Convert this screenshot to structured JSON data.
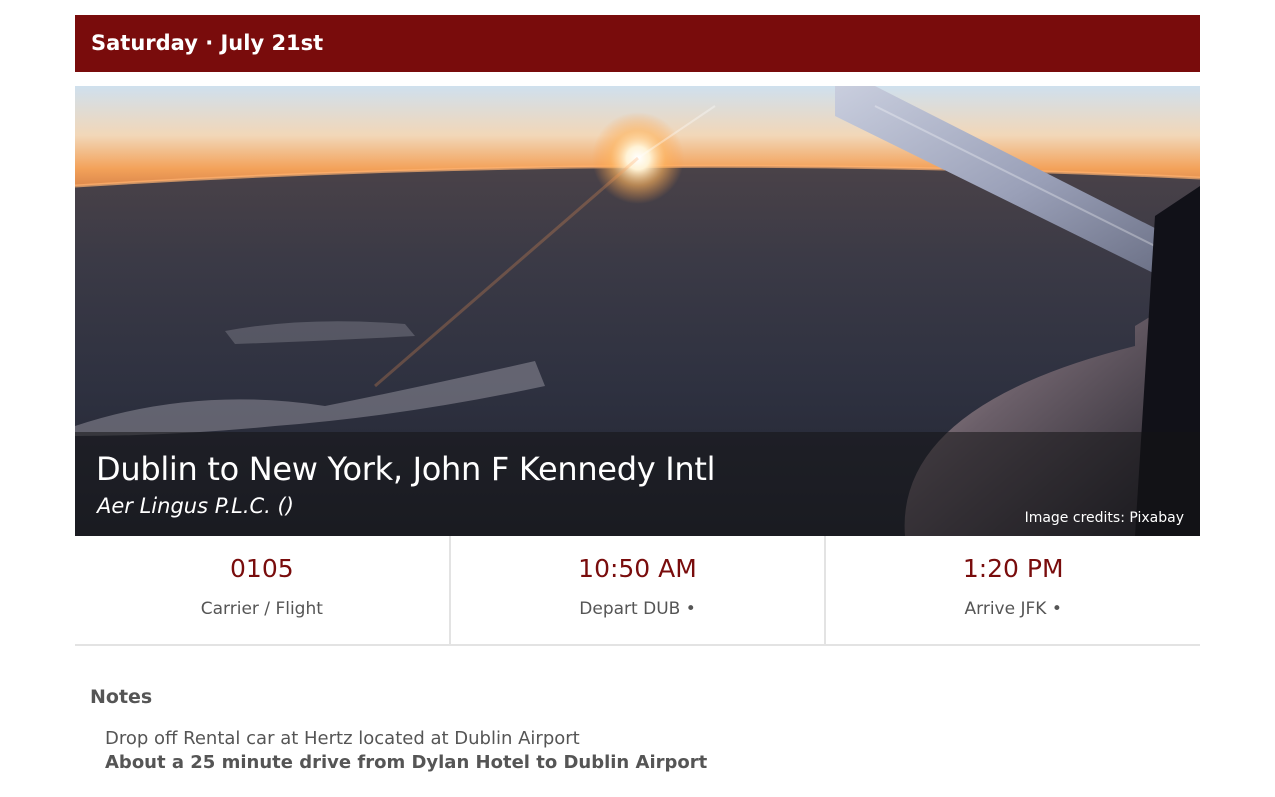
{
  "header": {
    "date_label": "Saturday · July 21st"
  },
  "hero": {
    "route_title": "Dublin to New York, John F Kennedy Intl",
    "airline": "Aer Lingus P.L.C. ()",
    "image_credit": "Image credits: Pixabay"
  },
  "stats": [
    {
      "value": "0105",
      "label": "Carrier / Flight"
    },
    {
      "value": "10:50 AM",
      "label": "Depart DUB •"
    },
    {
      "value": "1:20 PM",
      "label": "Arrive JFK •"
    }
  ],
  "notes": {
    "heading": "Notes",
    "lines": [
      "Drop off Rental car at Hertz located at Dublin Airport",
      "About a 25 minute drive from Dylan Hotel to Dublin Airport"
    ]
  },
  "colors": {
    "accent": "#790c0c",
    "divider": "#e3e3e3"
  }
}
